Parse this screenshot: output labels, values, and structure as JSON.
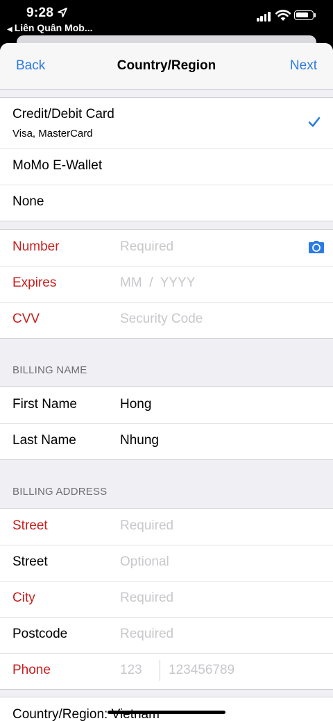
{
  "status_bar": {
    "time": "9:28",
    "back_app": "Liên Quân Mob..."
  },
  "nav": {
    "back": "Back",
    "title": "Country/Region",
    "next": "Next"
  },
  "payment_methods": [
    {
      "label": "Credit/Debit Card",
      "sublabel": "Visa, MasterCard",
      "selected": true
    },
    {
      "label": "MoMo E-Wallet"
    },
    {
      "label": "None"
    }
  ],
  "card": {
    "number_label": "Number",
    "number_placeholder": "Required",
    "expires_label": "Expires",
    "expires_placeholder": "MM  /  YYYY",
    "cvv_label": "CVV",
    "cvv_placeholder": "Security Code"
  },
  "billing_name": {
    "header": "BILLING NAME",
    "first_label": "First Name",
    "first_value": "Hong",
    "last_label": "Last Name",
    "last_value": "Nhung"
  },
  "billing_address": {
    "header": "BILLING ADDRESS",
    "street1_label": "Street",
    "street1_placeholder": "Required",
    "street2_label": "Street",
    "street2_placeholder": "Optional",
    "city_label": "City",
    "city_placeholder": "Required",
    "postcode_label": "Postcode",
    "postcode_placeholder": "Required",
    "phone_label": "Phone",
    "phone_code_placeholder": "123",
    "phone_number_placeholder": "123456789"
  },
  "country": {
    "label": "Country/Region: Vietnam"
  },
  "colors": {
    "accent": "#2a7be4",
    "required": "#c81e1e",
    "placeholder": "#c7c7cc",
    "group_bg": "#efeff4"
  },
  "icons": [
    "location-arrow-icon",
    "cellular-signal-icon",
    "wifi-icon",
    "battery-icon",
    "checkmark-icon",
    "camera-icon"
  ]
}
